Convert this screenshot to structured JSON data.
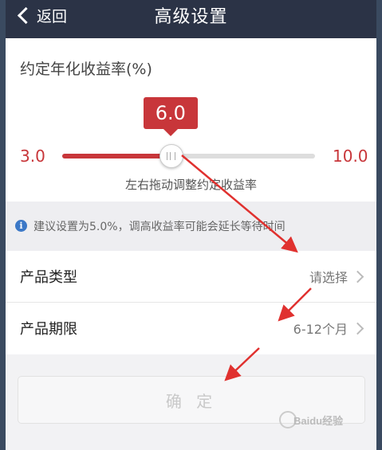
{
  "header": {
    "back_label": "返回",
    "title": "高级设置"
  },
  "rate": {
    "title": "约定年化收益率(%)",
    "value": "6.0",
    "min": "3.0",
    "max": "10.0",
    "hint": "左右拖动调整约定收益率",
    "slider": {
      "min": 3.0,
      "max": 10.0,
      "value": 6.0
    }
  },
  "tip": {
    "icon": "info-icon",
    "icon_glyph": "i",
    "text": "建议设置为5.0%，调高收益率可能会延长等待时间"
  },
  "options": [
    {
      "label": "产品类型",
      "value": "请选择"
    },
    {
      "label": "产品期限",
      "value": "6-12个月"
    }
  ],
  "confirm_label": "确 定",
  "watermark": "Baidu经验",
  "colors": {
    "header_bg": "#2b3346",
    "accent": "#c8363a",
    "info": "#3b78c7",
    "annotation_arrow": "#e0312f"
  }
}
